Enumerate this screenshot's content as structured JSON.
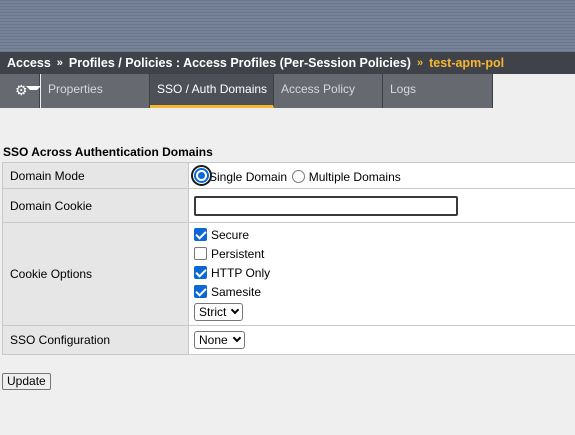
{
  "breadcrumb": {
    "items": [
      "Access",
      "Profiles / Policies : Access Profiles (Per-Session Policies)"
    ],
    "separator": "»",
    "current": "test-apm-pol"
  },
  "tabs": [
    {
      "label": "Properties",
      "active": false
    },
    {
      "label": "SSO / Auth Domains",
      "active": true
    },
    {
      "label": "Access Policy",
      "active": false
    },
    {
      "label": "Logs",
      "active": false
    }
  ],
  "settings_menu": {
    "icon": "gear-icon"
  },
  "section": {
    "title": "SSO Across Authentication Domains"
  },
  "form": {
    "domain_mode": {
      "label": "Domain Mode",
      "options": [
        "Single Domain",
        "Multiple Domains"
      ],
      "selected": "Single Domain"
    },
    "domain_cookie": {
      "label": "Domain Cookie",
      "value": ""
    },
    "cookie_options": {
      "label": "Cookie Options",
      "checkboxes": [
        {
          "label": "Secure",
          "checked": true
        },
        {
          "label": "Persistent",
          "checked": false
        },
        {
          "label": "HTTP Only",
          "checked": true
        },
        {
          "label": "Samesite",
          "checked": true
        }
      ],
      "samesite_value": "Strict"
    },
    "sso_configuration": {
      "label": "SSO Configuration",
      "value": "None"
    }
  },
  "actions": {
    "update_label": "Update"
  },
  "colors": {
    "accent": "#f7b531",
    "breadcrumb_bg": "#3f4349",
    "tab_bg": "#666a70",
    "checkbox_blue": "#0b67d4"
  }
}
